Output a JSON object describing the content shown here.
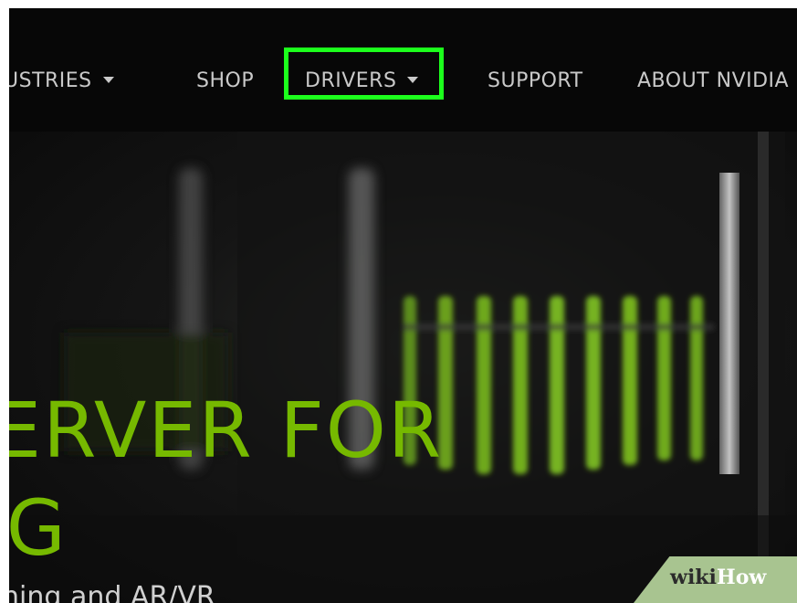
{
  "nav": {
    "items": [
      {
        "label": "USTRIES",
        "has_dropdown": true
      },
      {
        "label": "SHOP",
        "has_dropdown": false
      },
      {
        "label": "DRIVERS",
        "has_dropdown": true,
        "highlighted": true
      },
      {
        "label": "SUPPORT",
        "has_dropdown": false
      },
      {
        "label": "ABOUT NVIDIA",
        "has_dropdown": false
      }
    ]
  },
  "hero": {
    "line1": "ERVER FOR",
    "line2": "IG",
    "subtitle": "ning and AR/VR"
  },
  "watermark": {
    "part1": "wiki",
    "part2": "How"
  },
  "colors": {
    "accent": "#76b900",
    "highlight_box": "#1cff1c",
    "nav_text": "#c9c9c9",
    "background": "#0c0c0c"
  }
}
